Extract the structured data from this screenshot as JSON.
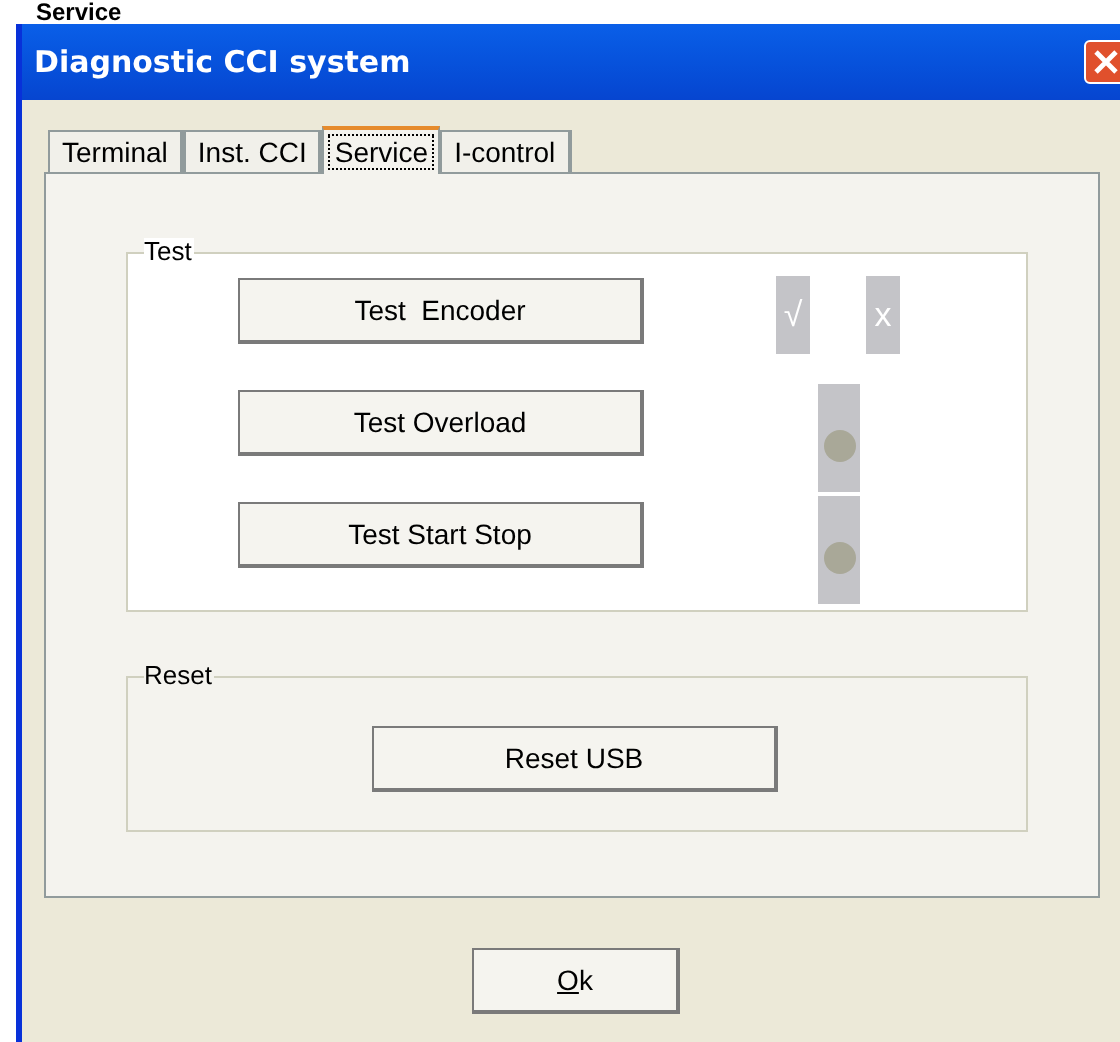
{
  "page_heading": "Service",
  "window": {
    "title": "Diagnostic CCI system"
  },
  "tabs": [
    {
      "label": "Terminal",
      "selected": false
    },
    {
      "label": "Inst. CCI",
      "selected": false
    },
    {
      "label": "Service",
      "selected": true
    },
    {
      "label": "I-control",
      "selected": false
    }
  ],
  "test_group": {
    "title": "Test",
    "buttons": [
      "Test  Encoder",
      "Test Overload",
      "Test Start Stop"
    ],
    "pass_mark": "√",
    "fail_mark": "x"
  },
  "reset_group": {
    "title": "Reset",
    "button": "Reset USB"
  },
  "ok_button": "Ok"
}
